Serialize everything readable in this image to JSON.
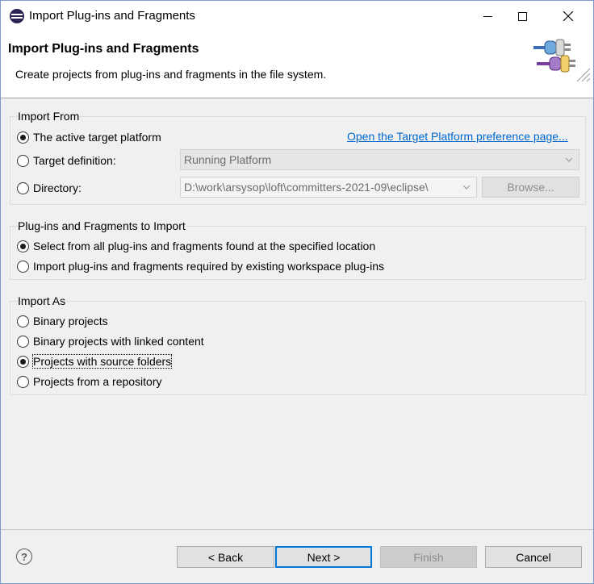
{
  "window": {
    "title": "Import Plug-ins and Fragments"
  },
  "banner": {
    "title": "Import Plug-ins and Fragments",
    "description": "Create projects from plug-ins and fragments in the file system."
  },
  "import_from": {
    "label": "Import From",
    "options": [
      {
        "label": "The active target platform",
        "checked": true
      },
      {
        "label": "Target definition:",
        "checked": false
      },
      {
        "label": "Directory:",
        "checked": false
      }
    ],
    "preference_link": "Open the Target Platform preference page...",
    "target_definition_value": "Running Platform",
    "directory_value": "D:\\work\\arsysop\\loft\\committers-2021-09\\eclipse\\",
    "browse_label": "Browse..."
  },
  "plugins_to_import": {
    "label": "Plug-ins and Fragments to Import",
    "options": [
      {
        "label": "Select from all plug-ins and fragments found at the specified location",
        "checked": true
      },
      {
        "label": "Import plug-ins and fragments required by existing workspace plug-ins",
        "checked": false
      }
    ]
  },
  "import_as": {
    "label": "Import As",
    "options": [
      {
        "label": "Binary projects",
        "checked": false
      },
      {
        "label": "Binary projects with linked content",
        "checked": false
      },
      {
        "label": "Projects with source folders",
        "checked": true
      },
      {
        "label": "Projects from a repository",
        "checked": false
      }
    ]
  },
  "buttons": {
    "help": "?",
    "back": "< Back",
    "next": "Next >",
    "finish": "Finish",
    "cancel": "Cancel"
  },
  "colors": {
    "link": "#0066cc",
    "default_button_border": "#0078d7",
    "window_background": "#f0f0f0"
  },
  "icons": {
    "app": "eclipse-icon",
    "banner": "plugin-import-graphic",
    "help": "help-icon"
  }
}
